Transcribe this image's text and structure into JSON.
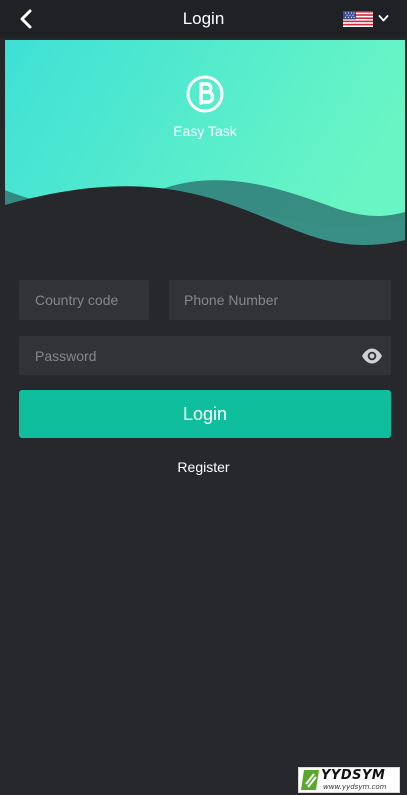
{
  "header": {
    "title": "Login",
    "back_icon": "chevron-left-icon",
    "language_icon": "us-flag-icon",
    "language_chevron_icon": "chevron-down-icon"
  },
  "hero": {
    "logo_icon": "easy-task-logo-icon",
    "brand_name": "Easy Task",
    "gradient_start": "#3ee0d6",
    "gradient_end": "#6af6c4"
  },
  "form": {
    "country_code_placeholder": "Country code",
    "phone_placeholder": "Phone Number",
    "password_placeholder": "Password",
    "password_toggle_icon": "eye-icon",
    "login_label": "Login",
    "register_label": "Register"
  },
  "colors": {
    "background": "#27282c",
    "field": "#323337",
    "accent": "#0fbe9c"
  },
  "watermark": {
    "text": "YYDSYM",
    "url": "www.yydsym.com"
  }
}
